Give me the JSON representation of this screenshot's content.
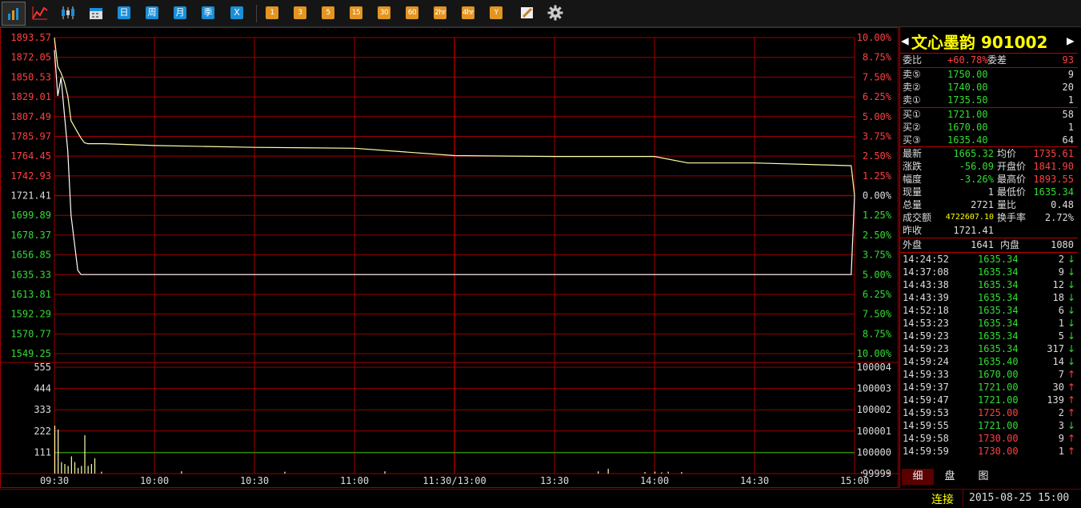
{
  "toolbar": {
    "icons": [
      "bar-chart-icon",
      "line-chart-icon",
      "candlestick-icon",
      "calendar-icon"
    ],
    "period_blue": [
      "日",
      "周",
      "月",
      "季",
      "X"
    ],
    "period_orange": [
      "1",
      "3",
      "5",
      "15",
      "30",
      "60",
      "2hr",
      "4hr",
      "Y"
    ],
    "tools": [
      "draw-pen-icon",
      "settings-gear-icon"
    ]
  },
  "chart": {
    "price_labels": [
      "1893.57",
      "1872.05",
      "1850.53",
      "1829.01",
      "1807.49",
      "1785.97",
      "1764.45",
      "1742.93",
      "1721.41",
      "1699.89",
      "1678.37",
      "1656.85",
      "1635.33",
      "1613.81",
      "1592.29",
      "1570.77",
      "1549.25"
    ],
    "pct_labels": [
      "10.00%",
      "8.75%",
      "7.50%",
      "6.25%",
      "5.00%",
      "3.75%",
      "2.50%",
      "1.25%",
      "0.00%",
      "1.25%",
      "2.50%",
      "3.75%",
      "5.00%",
      "6.25%",
      "7.50%",
      "8.75%",
      "10.00%"
    ],
    "vol_labels": [
      "555",
      "444",
      "333",
      "222",
      "111"
    ],
    "vol_right_labels": [
      "100004",
      "100003",
      "100002",
      "100001",
      "100000",
      "99999"
    ],
    "time_labels": [
      "09:30",
      "10:00",
      "10:30",
      "11:00",
      "11:30/13:00",
      "13:30",
      "14:00",
      "14:30",
      "15:00"
    ]
  },
  "chart_data": {
    "type": "line",
    "title": "",
    "xlabel": "",
    "ylabel": "",
    "prev_close": 1721.41,
    "ylim": [
      1549.25,
      1893.57
    ],
    "x": [
      "09:30",
      "09:31",
      "09:32",
      "09:33",
      "09:34",
      "09:35",
      "09:37",
      "09:38",
      "09:39",
      "09:40",
      "09:42",
      "09:45",
      "10:00",
      "10:30",
      "11:00",
      "11:15",
      "11:30",
      "13:30",
      "14:00",
      "14:10",
      "14:30",
      "14:59",
      "15:00"
    ],
    "series": [
      {
        "values": [
          1893.5,
          1862,
          1855,
          1845,
          1830,
          1803,
          1790,
          1784,
          1779,
          1778,
          1778,
          1778,
          1776,
          1774,
          1773,
          1769,
          1765,
          1764,
          1764,
          1757,
          1757,
          1754,
          1721.41
        ]
      },
      {
        "values": [
          1880,
          1830,
          1850,
          1810,
          1770,
          1700,
          1640,
          1635.34,
          1635.34,
          1635.34,
          1635.34,
          1635.34,
          1635.34,
          1635.34,
          1635.34,
          1635.34,
          1635.34,
          1635.34,
          1635.34,
          1635.34,
          1635.34,
          1635.34,
          1721.41
        ]
      }
    ],
    "volume": {
      "ylim": [
        0,
        555
      ],
      "bars": [
        [
          0,
          250
        ],
        [
          1,
          230
        ],
        [
          2,
          60
        ],
        [
          3,
          50
        ],
        [
          4,
          40
        ],
        [
          5,
          90
        ],
        [
          6,
          60
        ],
        [
          7,
          30
        ],
        [
          8,
          40
        ],
        [
          9,
          200
        ],
        [
          10,
          40
        ],
        [
          11,
          50
        ],
        [
          12,
          80
        ],
        [
          14,
          10
        ],
        [
          38,
          12
        ],
        [
          69,
          10
        ],
        [
          99,
          12
        ],
        [
          163,
          12
        ],
        [
          166,
          25
        ],
        [
          177,
          8
        ],
        [
          180,
          10
        ],
        [
          182,
          6
        ],
        [
          184,
          10
        ],
        [
          188,
          8
        ],
        [
          242,
          10
        ],
        [
          250,
          8
        ],
        [
          254,
          10
        ],
        [
          276,
          12
        ],
        [
          277,
          20
        ],
        [
          278,
          30
        ],
        [
          279,
          18
        ],
        [
          280,
          10
        ],
        [
          283,
          6
        ],
        [
          293,
          8
        ],
        [
          300,
          5
        ],
        [
          326,
          10
        ],
        [
          330,
          14
        ],
        [
          331,
          8
        ],
        [
          332,
          22
        ]
      ]
    }
  },
  "panel": {
    "title": "文心墨韵 901002",
    "weibi_label": "委比",
    "weibi_value": "+60.78%",
    "weicha_label": "委差",
    "weicha_value": "93",
    "asks": [
      {
        "label": "卖⑤",
        "price": "1750.00",
        "vol": "9"
      },
      {
        "label": "卖②",
        "price": "1740.00",
        "vol": "20"
      },
      {
        "label": "卖①",
        "price": "1735.50",
        "vol": "1"
      }
    ],
    "bids": [
      {
        "label": "买①",
        "price": "1721.00",
        "vol": "58"
      },
      {
        "label": "买②",
        "price": "1670.00",
        "vol": "1"
      },
      {
        "label": "买③",
        "price": "1635.40",
        "vol": "64"
      }
    ],
    "stats": [
      {
        "l1": "最新",
        "v1": "1665.32",
        "l2": "均价",
        "v2": "1735.61"
      },
      {
        "l1": "涨跌",
        "v1": "-56.09",
        "l2": "开盘价",
        "v2": "1841.90"
      },
      {
        "l1": "幅度",
        "v1": "-3.26%",
        "l2": "最高价",
        "v2": "1893.55"
      },
      {
        "l1": "现量",
        "v1": "1",
        "l2": "最低价",
        "v2": "1635.34"
      },
      {
        "l1": "总量",
        "v1": "2721",
        "l2": "量比",
        "v2": "0.48"
      },
      {
        "l1": "成交额",
        "v1": "4722607.10",
        "l2": "换手率",
        "v2": "2.72%"
      },
      {
        "l1": "昨收",
        "v1": "1721.41",
        "l2": "",
        "v2": ""
      }
    ],
    "waipan_label": "外盘",
    "waipan": "1641",
    "neipan_label": "内盘",
    "neipan": "1080",
    "ticks": [
      {
        "t": "14:24:52",
        "p": "1635.34",
        "v": "2",
        "d": "↓"
      },
      {
        "t": "14:37:08",
        "p": "1635.34",
        "v": "9",
        "d": "↓"
      },
      {
        "t": "14:43:38",
        "p": "1635.34",
        "v": "12",
        "d": "↓"
      },
      {
        "t": "14:43:39",
        "p": "1635.34",
        "v": "18",
        "d": "↓"
      },
      {
        "t": "14:52:18",
        "p": "1635.34",
        "v": "6",
        "d": "↓"
      },
      {
        "t": "14:53:23",
        "p": "1635.34",
        "v": "1",
        "d": "↓"
      },
      {
        "t": "14:59:23",
        "p": "1635.34",
        "v": "5",
        "d": "↓"
      },
      {
        "t": "14:59:23",
        "p": "1635.34",
        "v": "317",
        "d": "↓"
      },
      {
        "t": "14:59:24",
        "p": "1635.40",
        "v": "14",
        "d": "↓"
      },
      {
        "t": "14:59:33",
        "p": "1670.00",
        "v": "7",
        "d": "↑"
      },
      {
        "t": "14:59:37",
        "p": "1721.00",
        "v": "30",
        "d": "↑"
      },
      {
        "t": "14:59:47",
        "p": "1721.00",
        "v": "139",
        "d": "↑"
      },
      {
        "t": "14:59:53",
        "p": "1725.00",
        "v": "2",
        "d": "↑"
      },
      {
        "t": "14:59:55",
        "p": "1721.00",
        "v": "3",
        "d": "↓"
      },
      {
        "t": "14:59:58",
        "p": "1730.00",
        "v": "9",
        "d": "↑"
      },
      {
        "t": "14:59:59",
        "p": "1730.00",
        "v": "1",
        "d": "↑"
      }
    ],
    "tabs": [
      "细",
      "盘",
      "图"
    ]
  },
  "status": {
    "connection": "连接",
    "datetime": "2015-08-25 15:00"
  },
  "colors": {
    "up": "#ff4040",
    "down": "#33dd33",
    "grid": "#a00000",
    "price_line": "#ffffff",
    "avg_line": "#ffffaa",
    "yellow": "#ffff00",
    "cyan": "#00ffff"
  }
}
